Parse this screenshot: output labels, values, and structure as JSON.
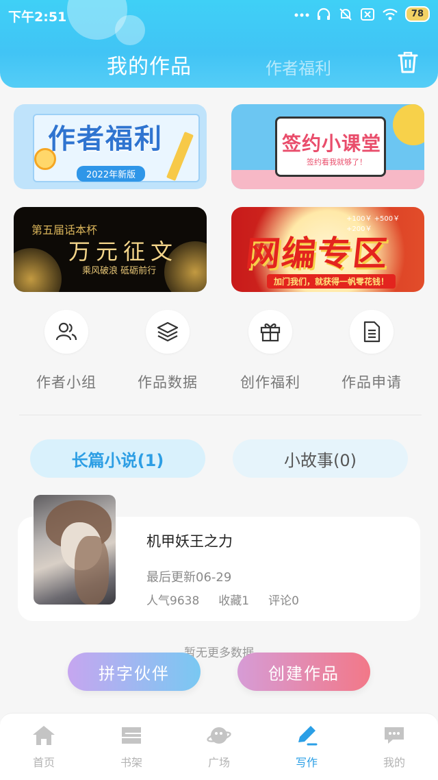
{
  "status_bar": {
    "time": "下午2:51",
    "battery": "78"
  },
  "header": {
    "tab_active": "我的作品",
    "tab_inactive": "作者福利"
  },
  "banners": [
    {
      "title": "作者福利",
      "subtitle": "2022年新版"
    },
    {
      "title": "签约小课堂",
      "subtitle": "签约看我就够了！"
    },
    {
      "small": "第五届话本杯",
      "title": "万元征文",
      "subtitle": "乘风破浪 砥砺前行"
    },
    {
      "title": "网编专区",
      "subtitle": "加门我们，就获得一帆零花钱！",
      "money": "+100￥ +500￥ +200￥"
    }
  ],
  "quick_actions": [
    {
      "label": "作者小组",
      "icon": "group-icon"
    },
    {
      "label": "作品数据",
      "icon": "layers-icon"
    },
    {
      "label": "创作福利",
      "icon": "gift-icon"
    },
    {
      "label": "作品申请",
      "icon": "document-icon"
    }
  ],
  "segments": {
    "novel": "长篇小说(1)",
    "story": "小故事(0)"
  },
  "works": [
    {
      "title": "机甲妖王之力",
      "updated": "最后更新06-29",
      "popularity": "人气9638",
      "favorites": "收藏1",
      "comments": "评论0"
    }
  ],
  "no_more": "暂无更多数据",
  "fabs": {
    "partner": "拼字伙伴",
    "create": "创建作品"
  },
  "bottom_nav": [
    {
      "label": "首页",
      "icon": "home-icon"
    },
    {
      "label": "书架",
      "icon": "bookshelf-icon"
    },
    {
      "label": "广场",
      "icon": "planet-icon"
    },
    {
      "label": "写作",
      "icon": "pen-icon"
    },
    {
      "label": "我的",
      "icon": "chat-bubble-icon"
    }
  ],
  "colors": {
    "accent": "#2b9fe6",
    "header": "#41c4f5"
  }
}
